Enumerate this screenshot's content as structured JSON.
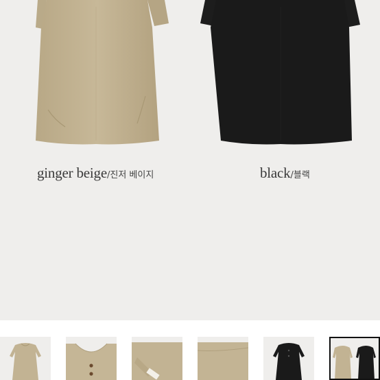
{
  "products": [
    {
      "color_en": "ginger beige",
      "color_ko": "/진저 베이지",
      "swatch": "#c2b393"
    },
    {
      "color_en": "black",
      "color_ko": "/블랙",
      "swatch": "#1a1a1a"
    }
  ],
  "thumbnails": [
    {
      "name": "beige-front",
      "selected": false
    },
    {
      "name": "beige-collar-detail",
      "selected": false
    },
    {
      "name": "beige-sleeve-detail",
      "selected": false
    },
    {
      "name": "beige-fabric-detail",
      "selected": false
    },
    {
      "name": "black-front",
      "selected": false
    },
    {
      "name": "both-colors",
      "selected": true
    }
  ],
  "colors": {
    "background": "#efeeec",
    "beige": "#c2b393",
    "black": "#1a1a1a",
    "selected_border": "#111111"
  }
}
